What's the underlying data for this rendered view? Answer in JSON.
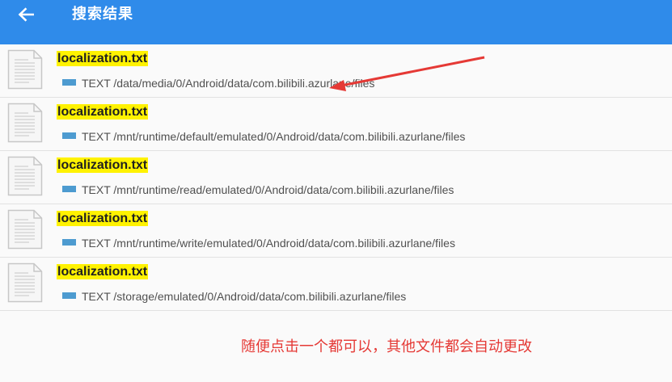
{
  "header": {
    "back_icon": "arrow-left-icon",
    "title": "搜索结果",
    "bg_color": "#2f8bea"
  },
  "results": [
    {
      "name": "localization.txt",
      "type": "TEXT",
      "path": "/data/media/0/Android/data/com.bilibili.azurlane/files"
    },
    {
      "name": "localization.txt",
      "type": "TEXT",
      "path": "/mnt/runtime/default/emulated/0/Android/data/com.bilibili.azurlane/files"
    },
    {
      "name": "localization.txt",
      "type": "TEXT",
      "path": "/mnt/runtime/read/emulated/0/Android/data/com.bilibili.azurlane/files"
    },
    {
      "name": "localization.txt",
      "type": "TEXT",
      "path": "/mnt/runtime/write/emulated/0/Android/data/com.bilibili.azurlane/files"
    },
    {
      "name": "localization.txt",
      "type": "TEXT",
      "path": "/storage/emulated/0/Android/data/com.bilibili.azurlane/files"
    }
  ],
  "annotation": {
    "note": "随便点击一个都可以，其他文件都会自动更改",
    "color": "#e53935"
  },
  "highlight_color": "#fff200",
  "file_icon": "text-file-icon"
}
